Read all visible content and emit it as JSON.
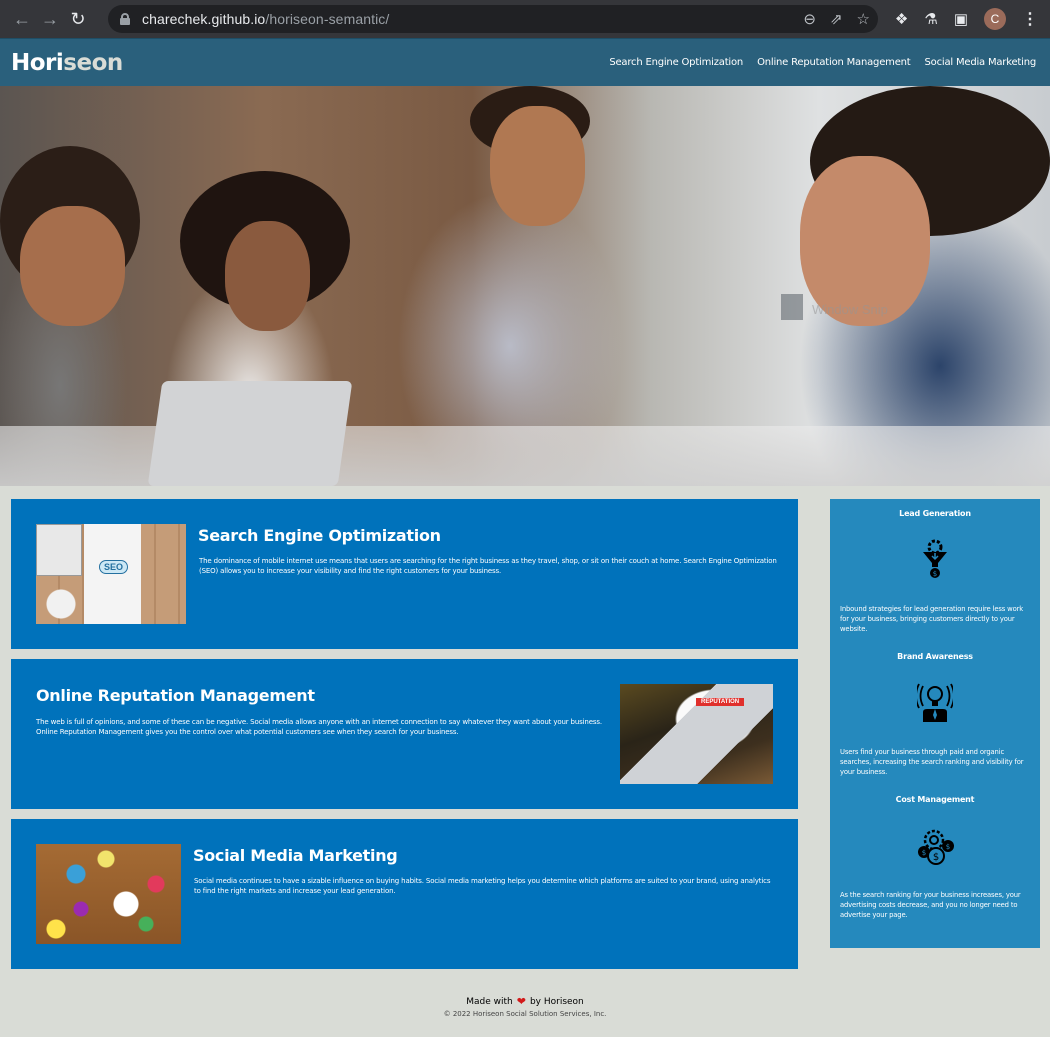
{
  "browser": {
    "url_host": "charechek.github.io",
    "url_path": "/horiseon-semantic/",
    "profile_initial": "C",
    "icons": [
      "back-icon",
      "forward-icon",
      "reload-icon",
      "lock-icon",
      "zoom-out-icon",
      "share-icon",
      "bookmark-star-icon",
      "extensions-puzzle-icon",
      "labs-flask-icon",
      "side-panel-icon",
      "profile-avatar",
      "menu-kebab-icon"
    ]
  },
  "header": {
    "logo_part1": "Hori",
    "logo_part2": "seon",
    "nav": [
      {
        "label": "Search Engine Optimization"
      },
      {
        "label": "Online Reputation Management"
      },
      {
        "label": "Social Media Marketing"
      }
    ]
  },
  "hero": {
    "watermark": "Window Snip"
  },
  "content": [
    {
      "title": "Search Engine Optimization",
      "body": "The dominance of mobile internet use means that users are searching for the right business as they travel, shop, or sit on their couch at home. Search Engine Optimization (SEO) allows you to increase your visibility and find the right customers for your business.",
      "image_alt": "SEO planning notebook on desk"
    },
    {
      "title": "Online Reputation Management",
      "body": "The web is full of opinions, and some of these can be negative. Social media allows anyone with an internet connection to say whatever they want about your business. Online Reputation Management gives you the control over what potential customers see when they search for your business.",
      "image_alt": "Laptop showing reputation dashboard"
    },
    {
      "title": "Social Media Marketing",
      "body": "Social media continues to have a sizable influence on buying habits. Social media marketing helps you determine which platforms are suited to your brand, using analytics to find the right markets and increase your lead generation.",
      "image_alt": "Social media icons over a table"
    }
  ],
  "benefits": [
    {
      "title": "Lead Generation",
      "icon": "lead-funnel-icon",
      "body": "Inbound strategies for lead generation require less work for your business, bringing customers directly to your website."
    },
    {
      "title": "Brand Awareness",
      "icon": "lightbulb-broadcast-icon",
      "body": "Users find your business through paid and organic searches, increasing the search ranking and visibility for your business."
    },
    {
      "title": "Cost Management",
      "icon": "gear-coins-icon",
      "body": "As the search ranking for your business increases, your advertising costs decrease, and you no longer need to advertise your page."
    }
  ],
  "footer": {
    "made_with": "Made with",
    "by": "by Horiseon",
    "copyright": "© 2022 Horiseon Social Solution Services, Inc."
  },
  "colors": {
    "header_bg": "#2a607c",
    "card_bg": "#0072bb",
    "sidebar_bg": "#2589bd",
    "page_bg": "#d9dcd6",
    "heart": "#d21a1a"
  }
}
